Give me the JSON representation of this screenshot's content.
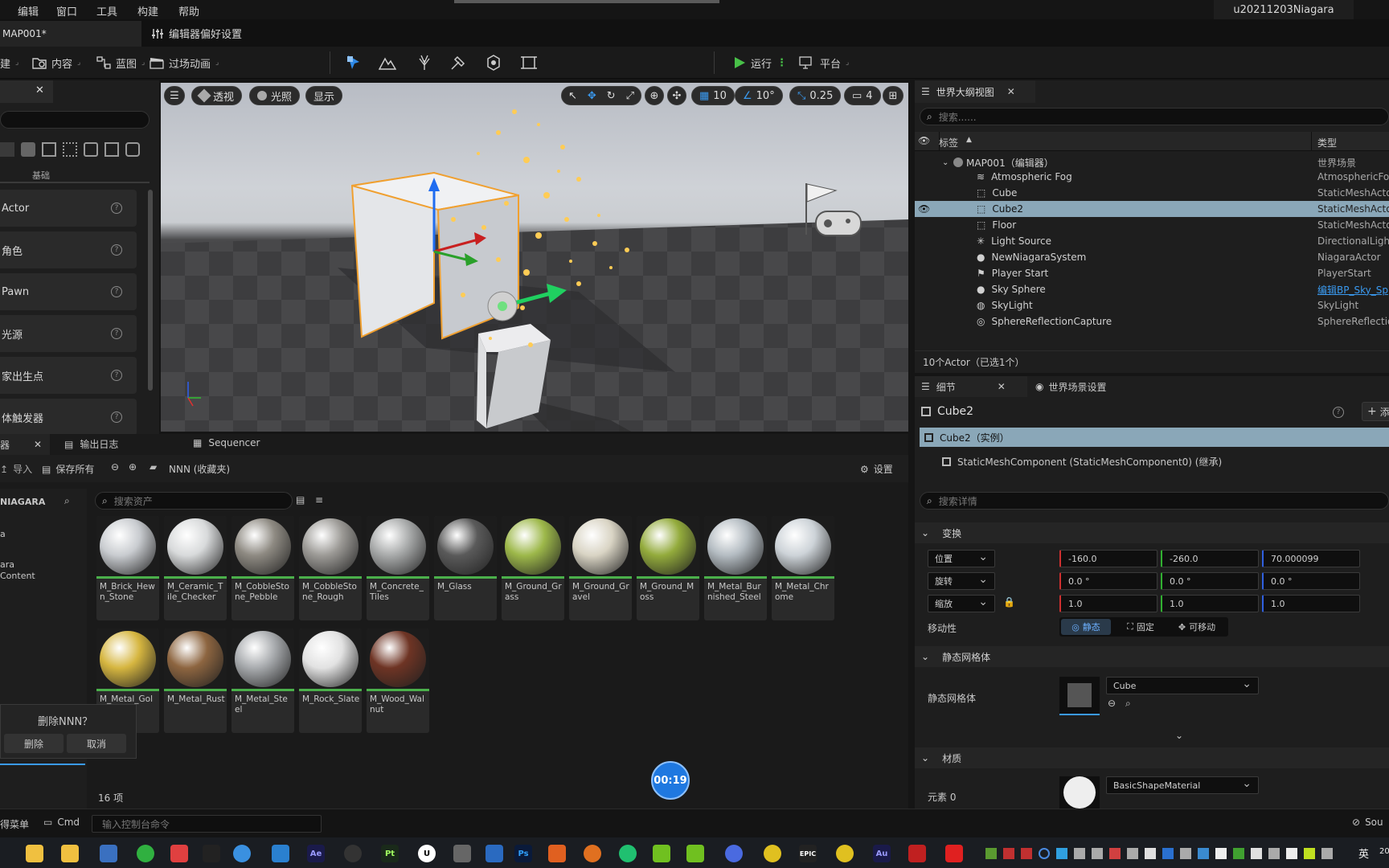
{
  "menu": {
    "items": [
      "编辑",
      "窗口",
      "工具",
      "构建",
      "帮助"
    ],
    "project": "u20211203Niagara"
  },
  "tabs": {
    "map": "MAP001*",
    "prefs": "编辑器偏好设置"
  },
  "toolbar": {
    "create": "建",
    "content": "内容",
    "blueprint": "蓝图",
    "cinematic": "过场动画",
    "play": "运行",
    "platform": "平台"
  },
  "place_panel": {
    "category": "基础",
    "items": [
      "Actor",
      "角色",
      "Pawn",
      "光源",
      "家出生点",
      "体触发器"
    ]
  },
  "viewport": {
    "perspective": "透视",
    "lit": "光照",
    "show": "显示",
    "grid_snap": "10",
    "angle_snap": "10°",
    "scale_snap": "0.25",
    "camera_speed": "4"
  },
  "outliner": {
    "title": "世界大纲视图",
    "search_placeholder": "搜索......",
    "col_label": "标签",
    "col_type": "类型",
    "root": {
      "name": "MAP001（编辑器）",
      "type": "世界场景"
    },
    "rows": [
      {
        "name": "Atmospheric Fog",
        "type": "AtmosphericFog",
        "icon": "fog-icon"
      },
      {
        "name": "Cube",
        "type": "StaticMeshActor",
        "icon": "cube-icon"
      },
      {
        "name": "Cube2",
        "type": "StaticMeshActor",
        "icon": "cube-icon",
        "selected": true
      },
      {
        "name": "Floor",
        "type": "StaticMeshActor",
        "icon": "cube-icon"
      },
      {
        "name": "Light Source",
        "type": "DirectionalLight",
        "icon": "sun-icon"
      },
      {
        "name": "NewNiagaraSystem",
        "type": "NiagaraActor",
        "icon": "sphere-icon"
      },
      {
        "name": "Player Start",
        "type": "PlayerStart",
        "icon": "flag-icon"
      },
      {
        "name": "Sky Sphere",
        "type": "编辑BP_Sky_Sp",
        "icon": "sphere-icon",
        "link": true
      },
      {
        "name": "SkyLight",
        "type": "SkyLight",
        "icon": "skylight-icon"
      },
      {
        "name": "SphereReflectionCapture",
        "type": "SphereReflection",
        "icon": "reflection-icon"
      }
    ],
    "footer": "10个Actor（已选1个）"
  },
  "details": {
    "tab_details": "细节",
    "tab_world": "世界场景设置",
    "object": "Cube2",
    "add_label": "添",
    "instance": "Cube2（实例）",
    "component": "StaticMeshComponent (StaticMeshComponent0) (继承)",
    "search_placeholder": "搜索详情",
    "transform_header": "变换",
    "location_label": "位置",
    "rotation_label": "旋转",
    "scale_label": "缩放",
    "location": [
      "-160.0",
      "-260.0",
      "70.000099"
    ],
    "rotation": [
      "0.0 °",
      "0.0 °",
      "0.0 °"
    ],
    "scale": [
      "1.0",
      "1.0",
      "1.0"
    ],
    "mobility_label": "移动性",
    "mobility": [
      "静态",
      "固定",
      "可移动"
    ],
    "mesh_header": "静态网格体",
    "mesh_label": "静态网格体",
    "mesh_value": "Cube",
    "material_header": "材质",
    "element_label": "元素 0",
    "material_value": "BasicShapeMaterial"
  },
  "content_browser": {
    "tab_browser": "器",
    "tab_log": "输出日志",
    "tab_sequencer": "Sequencer",
    "import": "导入",
    "save_all": "保存所有",
    "path": "NNN (收藏夹)",
    "settings": "设置",
    "folder_root": "NIAGARA",
    "tree_items": [
      "a",
      "ara",
      "Content"
    ],
    "search_placeholder": "搜索资产",
    "count": "16 项",
    "assets": [
      {
        "name": "M_Brick_Hewn_Stone",
        "color": "#c9ccd0"
      },
      {
        "name": "M_Ceramic_Tile_Checker",
        "color": "#d8dadb"
      },
      {
        "name": "M_CobbleStone_Pebble",
        "color": "#8e8a82"
      },
      {
        "name": "M_CobbleStone_Rough",
        "color": "#9c9a96"
      },
      {
        "name": "M_Concrete_Tiles",
        "color": "#a8aaaa"
      },
      {
        "name": "M_Glass",
        "color": "#5a5a5a"
      },
      {
        "name": "M_Ground_Grass",
        "color": "#9db84a"
      },
      {
        "name": "M_Ground_Gravel",
        "color": "#d9d4c4"
      },
      {
        "name": "M_Ground_Moss",
        "color": "#93ab3c"
      },
      {
        "name": "M_Metal_Burnished_Steel",
        "color": "#b4bcc2"
      },
      {
        "name": "M_Metal_Chrome",
        "color": "#cdd3d8"
      },
      {
        "name": "M_Metal_Gold",
        "color": "#d6b640"
      },
      {
        "name": "M_Metal_Rust",
        "color": "#8d6540"
      },
      {
        "name": "M_Metal_Steel",
        "color": "#a8abae"
      },
      {
        "name": "M_Rock_Slate",
        "color": "#e2e2e2"
      },
      {
        "name": "M_Wood_Walnut",
        "color": "#6e3424"
      }
    ]
  },
  "dialog": {
    "title": "删除NNN？",
    "delete": "删除",
    "cancel": "取消"
  },
  "timer": "00:19",
  "cmd": {
    "menu": "得菜单",
    "cmd": "Cmd",
    "placeholder": "输入控制台命令",
    "source": "Sou"
  },
  "taskbar": {
    "ime": "英",
    "year": "20"
  }
}
